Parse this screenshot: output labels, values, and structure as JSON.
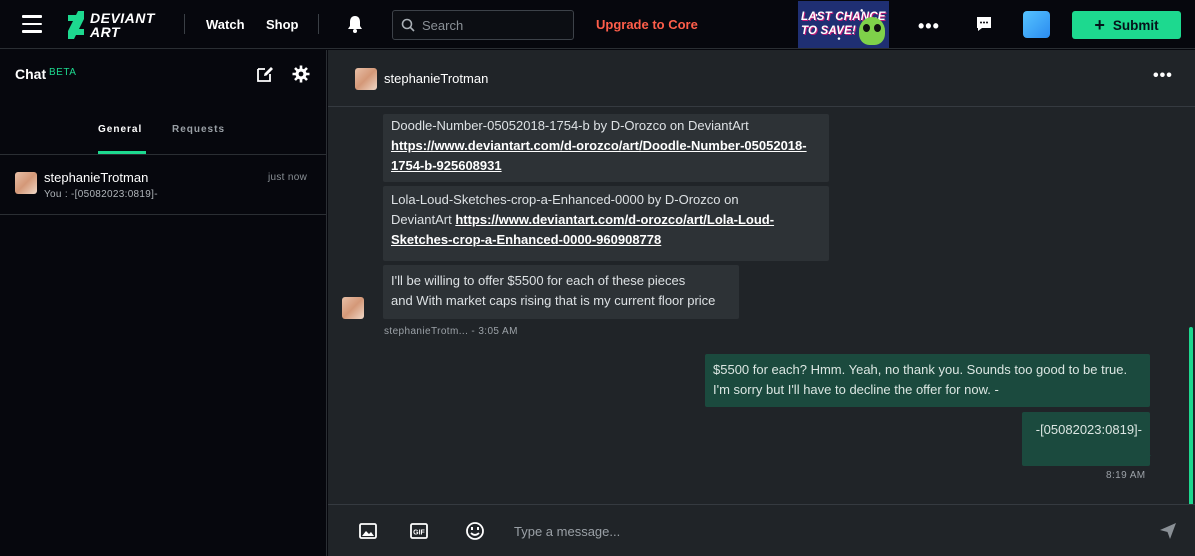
{
  "topbar": {
    "logo_line1": "DEVIANT",
    "logo_line2": "ART",
    "watch": "Watch",
    "shop": "Shop",
    "search_placeholder": "Search",
    "upgrade": "Upgrade to Core",
    "promo_line1": "LAST CHANCE",
    "promo_line2": "TO SAVE!",
    "more": "•••",
    "submit": "Submit",
    "submit_color": "#1dd98f",
    "upgrade_color": "#ff5e4a"
  },
  "sidebar": {
    "title": "Chat",
    "badge": "BETA",
    "tabs": [
      {
        "label": "General"
      },
      {
        "label": "Requests"
      }
    ],
    "conversations": [
      {
        "name": "stephanieTrotman",
        "time": "just now",
        "preview": "You : -[05082023:0819]-"
      }
    ]
  },
  "chat": {
    "header_name": "stephanieTrotman",
    "more": "•••",
    "messages": [
      {
        "text": "Doodle-Number-05052018-1754-b by D-Orozco on DeviantArt",
        "link_line1": "https://www.deviantart.com/d-orozco/art/Doodle-Number-05052018-",
        "link_line2": "1754-b-925608931"
      },
      {
        "text_line1": "Lola-Loud-Sketches-crop-a-Enhanced-0000 by D-Orozco on",
        "text_line2": "DeviantArt ",
        "link_line1": "https://www.deviantart.com/d-orozco/art/Lola-Loud-",
        "link_line2": "Sketches-crop-a-Enhanced-0000-960908778"
      },
      {
        "line1": "I'll be willing to offer $5500 for each of these pieces",
        "line2": "and With market caps rising that is my current floor price"
      }
    ],
    "incoming_meta": "stephanieTrotm...  - 3:05 AM",
    "outgoing": [
      {
        "line1": "$5500 for each? Hmm. Yeah, no thank you. Sounds too good to be true.",
        "line2": "I'm sorry but I'll have to decline the offer for now. -"
      },
      {
        "line1": "-[05082023:0819]-"
      }
    ],
    "outgoing_meta": "8:19 AM",
    "composer_placeholder": "Type a message..."
  }
}
